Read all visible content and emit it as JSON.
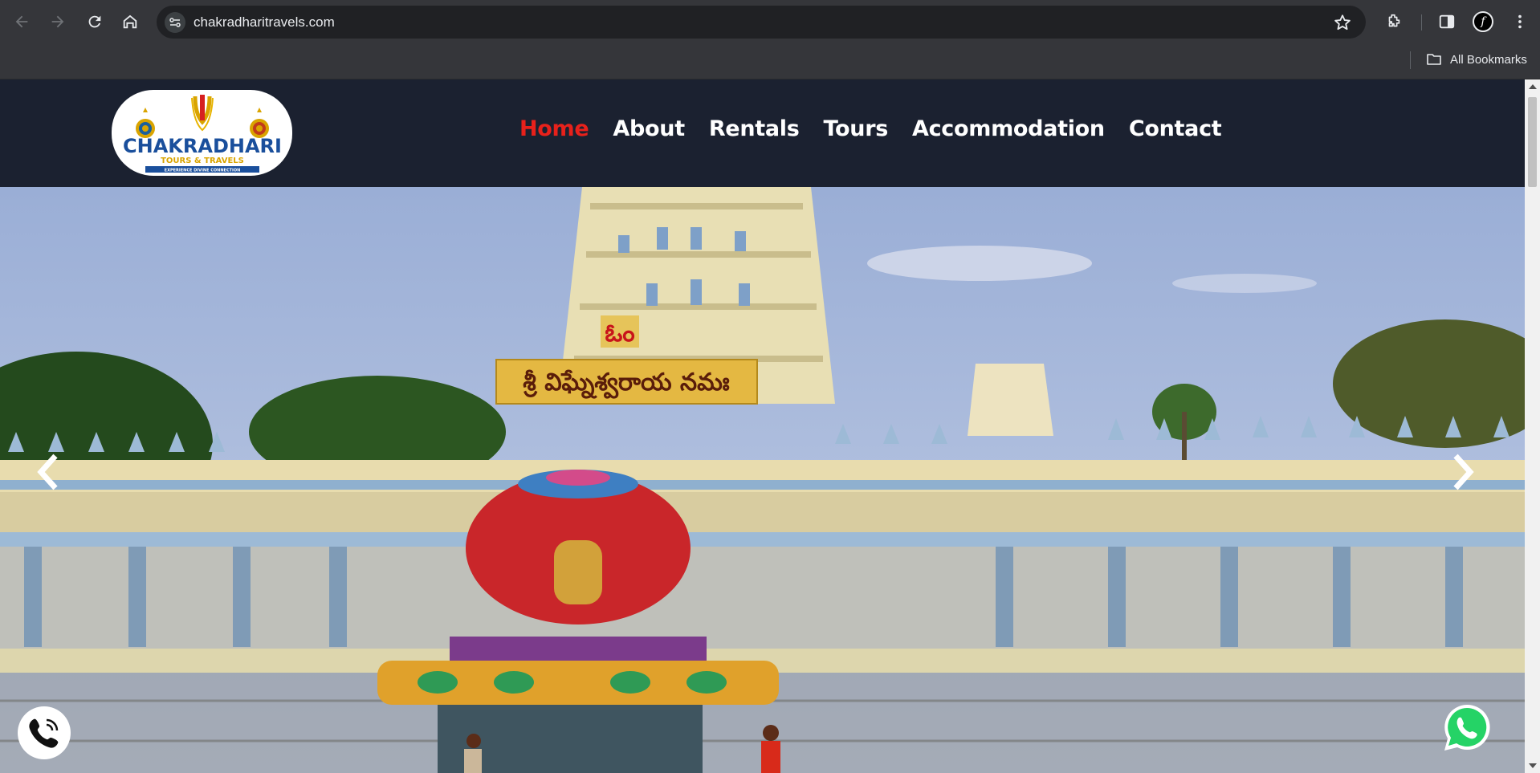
{
  "browser": {
    "url": "chakradharitravels.com",
    "bookmarks_label": "All Bookmarks",
    "profile_initial": "f",
    "icons": [
      "back-icon",
      "forward-icon",
      "reload-icon",
      "home-icon",
      "site-info-icon",
      "star-icon",
      "extensions-icon",
      "side-panel-icon",
      "profile-avatar",
      "kebab-menu-icon",
      "folder-icon"
    ]
  },
  "site": {
    "logo": {
      "brand": "CHAKRADHARI",
      "sub": "TOURS & TRAVELS",
      "tagline": "EXPERIENCE DIVINE CONNECTION"
    },
    "nav": [
      "Home",
      "About",
      "Rentals",
      "Tours",
      "Accommodation",
      "Contact"
    ],
    "active_nav": "Home",
    "hero": {
      "sign_top": "ఓం",
      "sign_main": "శ్రీ విఘ్నేశ్వరాయ నమః"
    }
  },
  "colors": {
    "header_bg": "#1b2130",
    "nav_active": "#e8211b",
    "nav_text": "#ffffff",
    "whatsapp": "#25d366"
  }
}
